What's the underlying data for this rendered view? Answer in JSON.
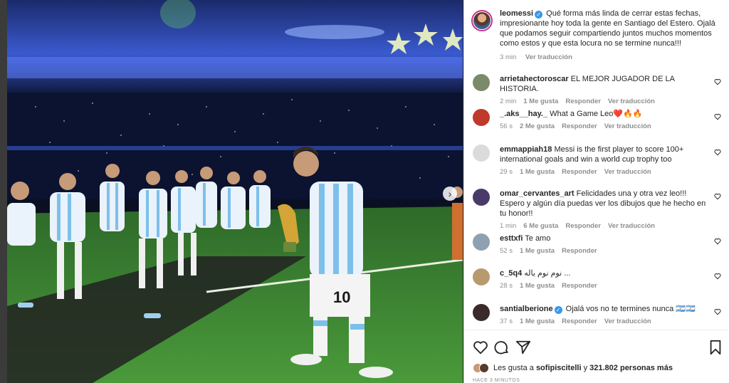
{
  "post": {
    "author": "leomessi",
    "verified_mark": "✓",
    "caption": "Qué forma más linda de cerrar estas fechas, impresionante hoy toda la gente en Santiago del Estero. Ojalá que podamos seguir compartiendo juntos muchos momentos como estos y que esta locura no se termine nunca!!!",
    "time": "3 min",
    "translate": "Ver traducción",
    "photo_jersey_number": "10"
  },
  "comments": [
    {
      "user": "arrietahectoroscar",
      "text": "EL MEJOR JUGADOR DE LA HISTORIA.",
      "time": "2 min",
      "likes": "1 Me gusta",
      "reply": "Responder",
      "translate": "Ver traducción",
      "avatar_color": "#7a8a6a"
    },
    {
      "user": "_.aks__hay._",
      "text": "What a Game Leo❤️🔥🔥",
      "time": "56 s",
      "likes": "2 Me gusta",
      "reply": "Responder",
      "translate": "Ver traducción",
      "avatar_color": "#c0392b"
    },
    {
      "user": "emmappiah18",
      "text": "Messi is the first player to score 100+ international goals and win a world cup trophy too",
      "time": "29 s",
      "likes": "1 Me gusta",
      "reply": "Responder",
      "translate": "Ver traducción",
      "avatar_color": "#dbdbdb"
    },
    {
      "user": "omar_cervantes_art",
      "text": "Felicidades una y otra vez leo!!! Espero y algún día puedas ver los dibujos que he hecho en tu honor!!",
      "time": "1 min",
      "likes": "6 Me gusta",
      "reply": "Responder",
      "translate": "Ver traducción",
      "avatar_color": "#4a3a6a"
    },
    {
      "user": "esttxfi",
      "text": "Te amo",
      "time": "52 s",
      "likes": "1 Me gusta",
      "reply": "Responder",
      "translate": "",
      "avatar_color": "#8fa0b0"
    },
    {
      "user": "c_5q4",
      "text": "نوم نوم ياله ...",
      "time": "28 s",
      "likes": "1 Me gusta",
      "reply": "Responder",
      "translate": "",
      "avatar_color": "#b89a70"
    },
    {
      "user": "santialberione",
      "text": "Ojalá vos no te termines nunca 🇦🇷🇦🇷",
      "time": "37 s",
      "likes": "1 Me gusta",
      "reply": "Responder",
      "translate": "Ver traducción",
      "avatar_color": "#3a2a2a",
      "verified": true
    }
  ],
  "actions": {
    "like_icon": "heart-icon",
    "comment_icon": "comment-icon",
    "share_icon": "send-icon",
    "save_icon": "bookmark-icon"
  },
  "likes_line": {
    "prefix": "Les gusta a",
    "user": "sofipiscitelli",
    "middle": "y",
    "count": "321.802",
    "suffix": "personas más"
  },
  "time_ago": "HACE 3 MINUTOS",
  "colors": {
    "verified": "#3897f0",
    "avatar_ring": "#c8348f",
    "text": "#262626",
    "muted": "#8e8e8e"
  }
}
